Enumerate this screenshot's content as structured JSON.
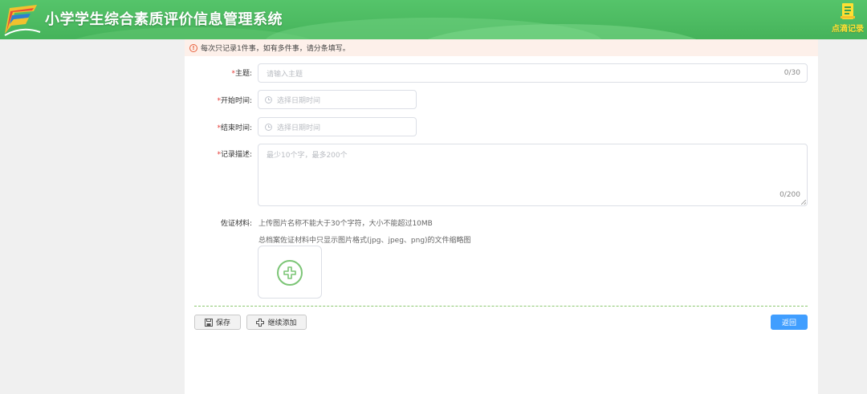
{
  "header": {
    "title": "小学学生综合素质评价信息管理系统",
    "record_link": "点滴记录"
  },
  "notice": {
    "text": "每次只记录1件事，如有多件事，请分条填写。"
  },
  "form": {
    "subject": {
      "required": "*",
      "label": "主题:",
      "placeholder": "请输入主题",
      "counter": "0/30"
    },
    "start_time": {
      "required": "*",
      "label": "开始时间:",
      "placeholder": "选择日期时间"
    },
    "end_time": {
      "required": "*",
      "label": "结束时间:",
      "placeholder": "选择日期时间"
    },
    "description": {
      "required": "*",
      "label": "记录描述:",
      "placeholder": "最少10个字，最多200个",
      "counter": "0/200"
    },
    "evidence": {
      "label": "佐证材料:",
      "hint1": "上传图片名称不能大于30个字符，大小不能超过10MB",
      "hint2": "总档案佐证材料中只显示图片格式(jpg、jpeg、png)的文件缩略图"
    }
  },
  "actions": {
    "save": "保存",
    "continue_add": "继续添加",
    "back": "返回"
  },
  "colors": {
    "header_green": "#4dbb62",
    "primary_blue": "#409eff",
    "required_red": "#e53935",
    "notice_bg": "#fdf0ea",
    "upload_green": "#7cc576"
  }
}
